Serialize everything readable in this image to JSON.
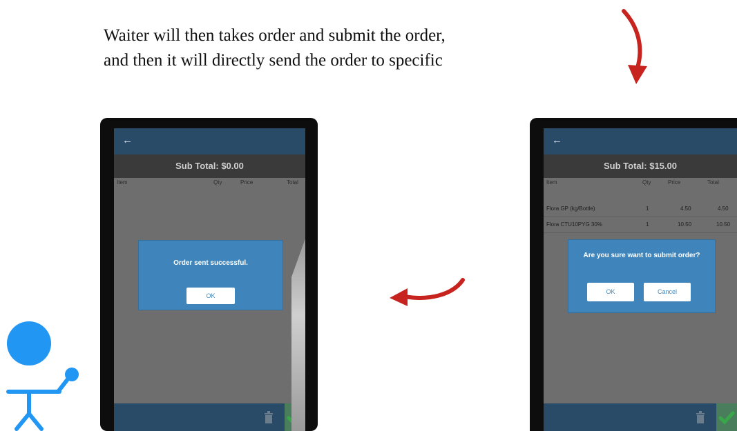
{
  "caption": {
    "line1": "Waiter will then takes order and submit the order,",
    "line2": "and then it will directly send the order to specific"
  },
  "left_screen": {
    "back_icon": "←",
    "subtotal": "Sub Total: $0.00",
    "columns": [
      "Item",
      "Qty",
      "Price",
      "Total"
    ],
    "dialog_message": "Order sent successful.",
    "ok_button": "OK",
    "icons": [
      "back-arrow-icon",
      "trash-icon",
      "checkmark-icon"
    ]
  },
  "right_screen": {
    "back_icon": "←",
    "subtotal": "Sub Total: $15.00",
    "columns": [
      "Item",
      "Qty",
      "Price",
      "Total"
    ],
    "rows": [
      {
        "item": "Flora GP (kg/Bottle)",
        "qty": "1",
        "price": "4.50",
        "total": "4.50"
      },
      {
        "item": "Flora CTU10PYG 30%",
        "qty": "1",
        "price": "10.50",
        "total": "10.50"
      }
    ],
    "dialog_message": "Are you sure want to submit order?",
    "ok_button": "OK",
    "cancel_button": "Cancel",
    "icons": [
      "back-arrow-icon",
      "trash-icon",
      "checkmark-icon"
    ]
  },
  "colors": {
    "app_bar": "#2a4b68",
    "dialog": "#3f85bb",
    "arrow": "#c8241f",
    "stick_figure": "#2196f3",
    "confirm": "#3aa64a"
  }
}
